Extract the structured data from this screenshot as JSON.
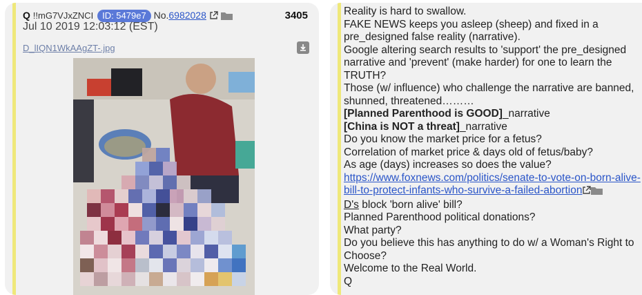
{
  "post": {
    "author": "Q",
    "tripcode": "!!mG7VJxZNCI",
    "id_badge": "ID: 5479e7",
    "post_number_label": "No.",
    "post_number": "6982028",
    "count": "3405",
    "date": "Jul 10 2019 12:03:12 (EST)",
    "attachment_filename": "D_lIQN1WkAAgZT-.jpg"
  },
  "message": {
    "l1": "Reality is hard to swallow.",
    "l2": "FAKE NEWS keeps you asleep (sheep) and fixed in a pre_designed false reality (narrative).",
    "l3": "Google altering search results to 'support' the pre_designed narrative and 'prevent' (make harder) for one to learn the TRUTH?",
    "l4": "Those (w/ influence) who challenge the narrative are banned, shunned, threatened………",
    "l5_bold": "[Planned Parenthood is GOOD]",
    "l5_rest": "_narrative",
    "l6_bold": "[China is NOT a threat]",
    "l6_rest": "_narrative",
    "l7": "Do you know the market price for a fetus?",
    "l8": "Correlation of market price & days old of fetus/baby?",
    "l9": "As age (days) increases so does the value?",
    "link": "https://www.foxnews.com/politics/senate-to-vote-on-born-alive-bill-to-protect-infants-who-survive-a-failed-abortion",
    "l10_underlined": "D's",
    "l10_rest": " block 'born alive' bill?",
    "l11": "Planned Parenthood political donations?",
    "l12": "What party?",
    "l13": "Do you believe this has anything to do w/ a Woman's Right to Choose?",
    "l14": "Welcome to the Real World.",
    "l15": "Q"
  },
  "icons": {
    "external_link": "external-link-icon",
    "folder": "folder-icon",
    "download": "download-icon"
  },
  "colors": {
    "card_bg": "#f1f1f1",
    "accent_bar": "#efe87a",
    "id_badge": "#5a79d8",
    "link": "#2a55c8"
  }
}
